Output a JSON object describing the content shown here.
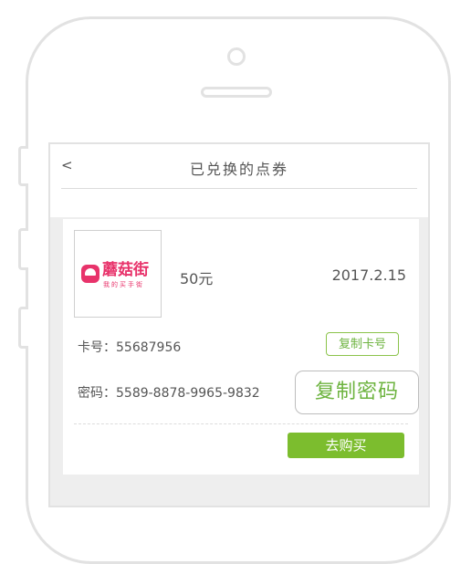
{
  "header": {
    "back_label": "<",
    "title": "已兑换的点券"
  },
  "coupon": {
    "logo": {
      "brand_main": "蘑菇街",
      "brand_sub": "我的买手街"
    },
    "amount": "50元",
    "date": "2017.2.15",
    "card_number_label": "卡号：",
    "card_number": "55687956",
    "password_label": "密码：",
    "password": "5589-8878-9965-9832",
    "copy_card_label": "复制卡号",
    "copy_password_label": "复制密码",
    "buy_label": "去购买"
  },
  "colors": {
    "brand": "#e8336b",
    "accent_green": "#7cbd2e",
    "text_green": "#6db33f"
  }
}
